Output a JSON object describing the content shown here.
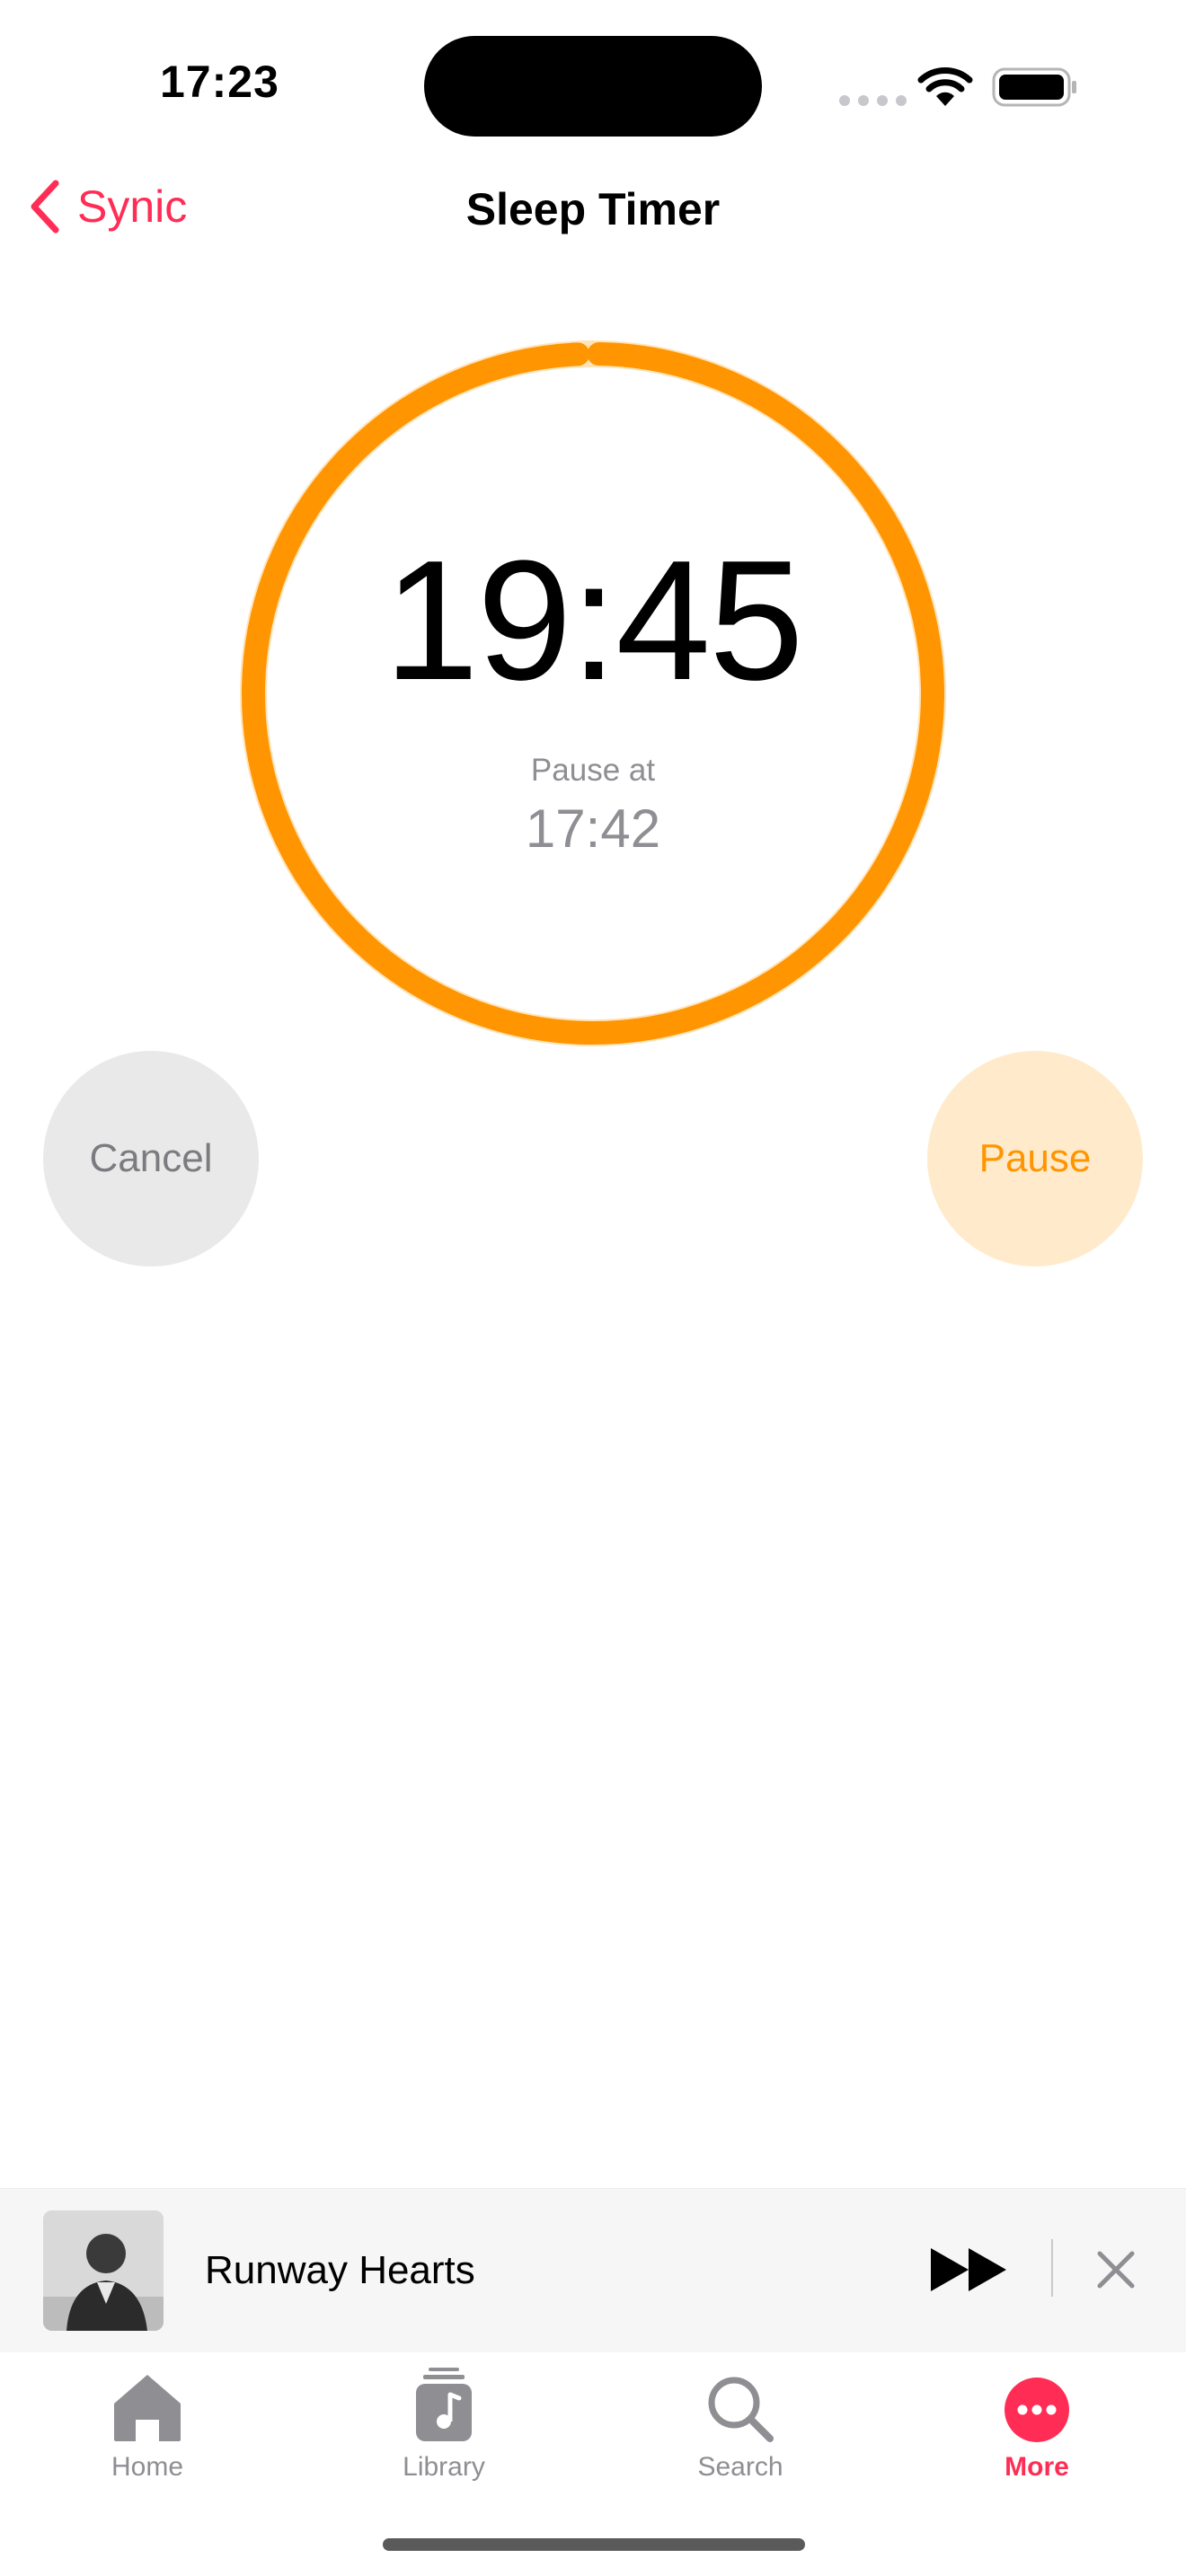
{
  "status_bar": {
    "time": "17:23"
  },
  "nav": {
    "back_label": "Synic",
    "title": "Sleep Timer"
  },
  "timer": {
    "remaining": "19:45",
    "pause_at_label": "Pause at",
    "pause_at_time": "17:42",
    "progress": 0.99
  },
  "buttons": {
    "cancel": "Cancel",
    "pause": "Pause"
  },
  "mini_player": {
    "title": "Runway Hearts"
  },
  "tabs": [
    {
      "label": "Home",
      "icon": "home-icon"
    },
    {
      "label": "Library",
      "icon": "library-icon"
    },
    {
      "label": "Search",
      "icon": "search-icon"
    },
    {
      "label": "More",
      "icon": "more-icon"
    }
  ],
  "colors": {
    "accent": "#ff2d55",
    "timer": "#ff9500",
    "timer_track": "#ffe3b8"
  }
}
